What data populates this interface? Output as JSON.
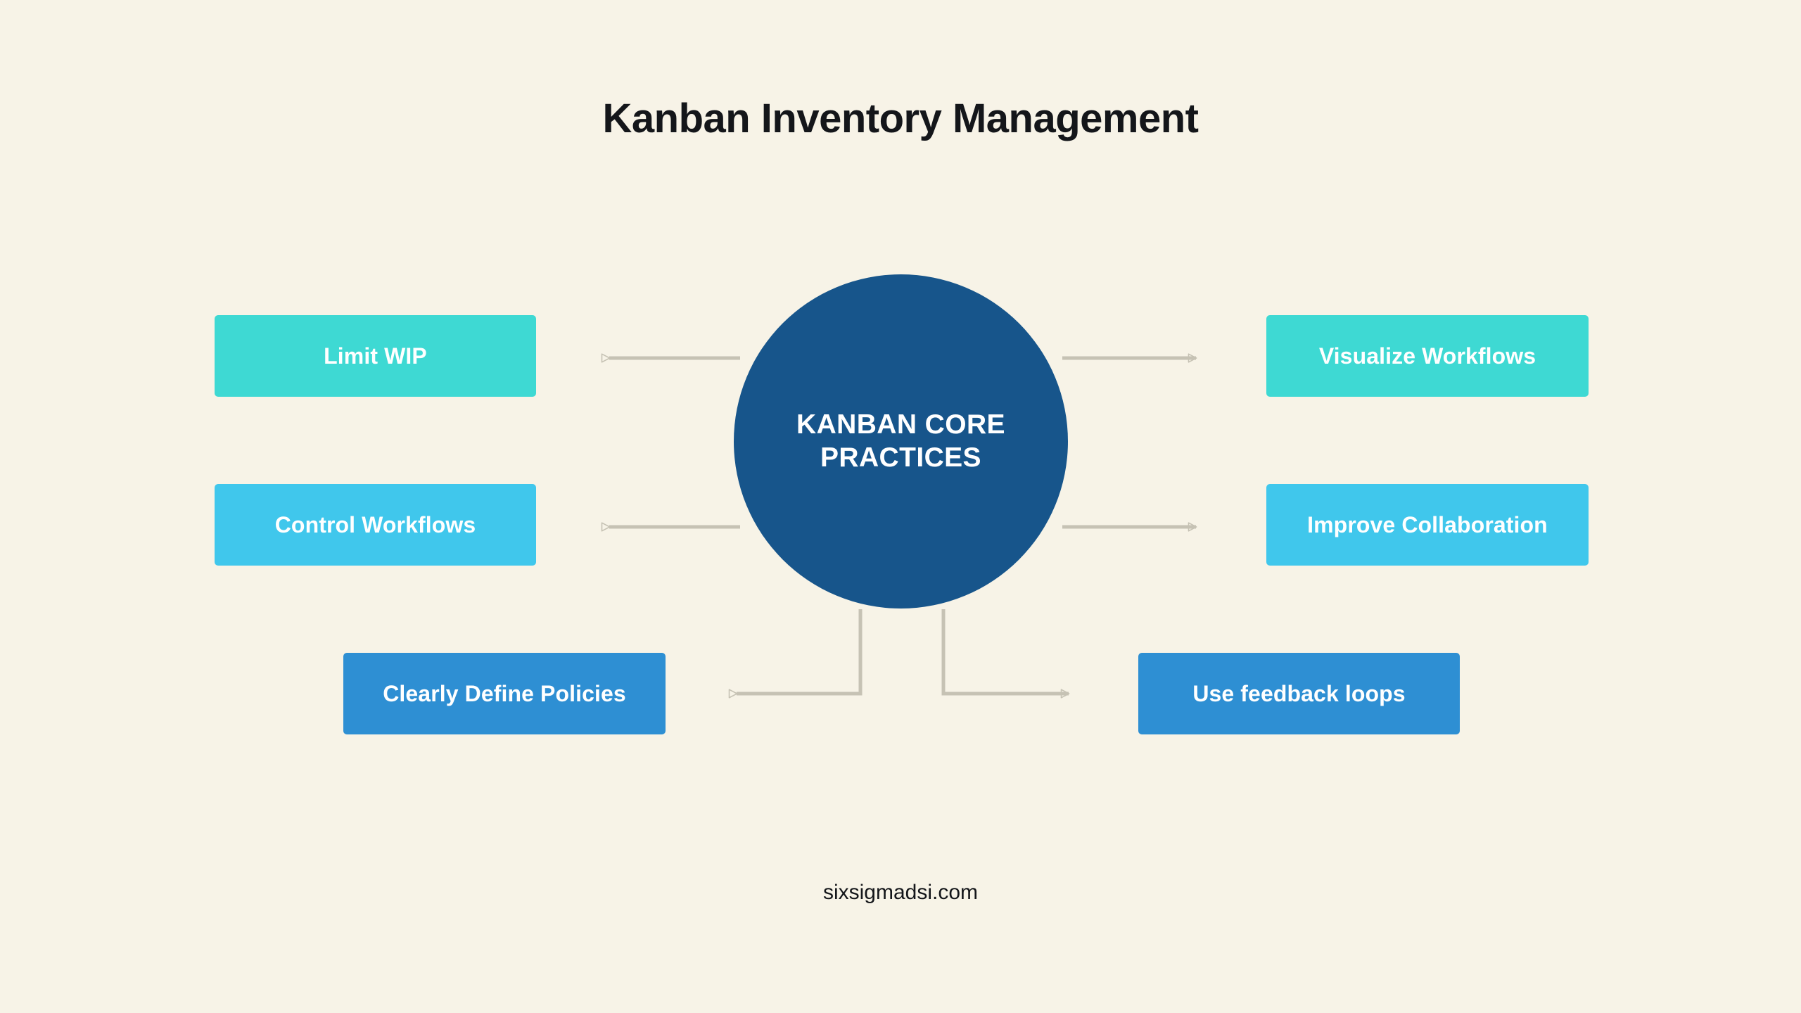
{
  "page": {
    "background_color": "#F7F3E7",
    "title": "Kanban Inventory Management",
    "footer_url": "sixsigmadsi.com"
  },
  "hub": {
    "label": "KANBAN CORE PRACTICES",
    "color": "#17558B",
    "text_color": "#FFFFFF"
  },
  "connectors": {
    "color": "#C6C2B4",
    "arrow_style": "hollow-triangle"
  },
  "chart_data": {
    "type": "diagram",
    "layout": "hub-and-spoke",
    "title": "Kanban Inventory Management",
    "center": "KANBAN CORE PRACTICES",
    "nodes": [
      {
        "label": "Limit WIP",
        "side": "left",
        "row": 1,
        "color": "#3ED9D3"
      },
      {
        "label": "Control Workflows",
        "side": "left",
        "row": 2,
        "color": "#40C7EC"
      },
      {
        "label": "Clearly Define Policies",
        "side": "left",
        "row": 3,
        "color": "#2E8FD3"
      },
      {
        "label": "Visualize Workflows",
        "side": "right",
        "row": 1,
        "color": "#3ED9D3"
      },
      {
        "label": "Improve Collaboration",
        "side": "right",
        "row": 2,
        "color": "#40C7EC"
      },
      {
        "label": "Use feedback loops",
        "side": "right",
        "row": 3,
        "color": "#2E8FD3"
      }
    ]
  },
  "boxes": {
    "limit_wip": {
      "label": "Limit WIP",
      "color": "#3ED9D3"
    },
    "control_wf": {
      "label": "Control Workflows",
      "color": "#40C7EC"
    },
    "define_policies": {
      "label": "Clearly Define Policies",
      "color": "#2E8FD3"
    },
    "visualize_wf": {
      "label": "Visualize Workflows",
      "color": "#3ED9D3"
    },
    "improve_collab": {
      "label": "Improve Collaboration",
      "color": "#40C7EC"
    },
    "feedback_loops": {
      "label": "Use feedback loops",
      "color": "#2E8FD3"
    }
  }
}
